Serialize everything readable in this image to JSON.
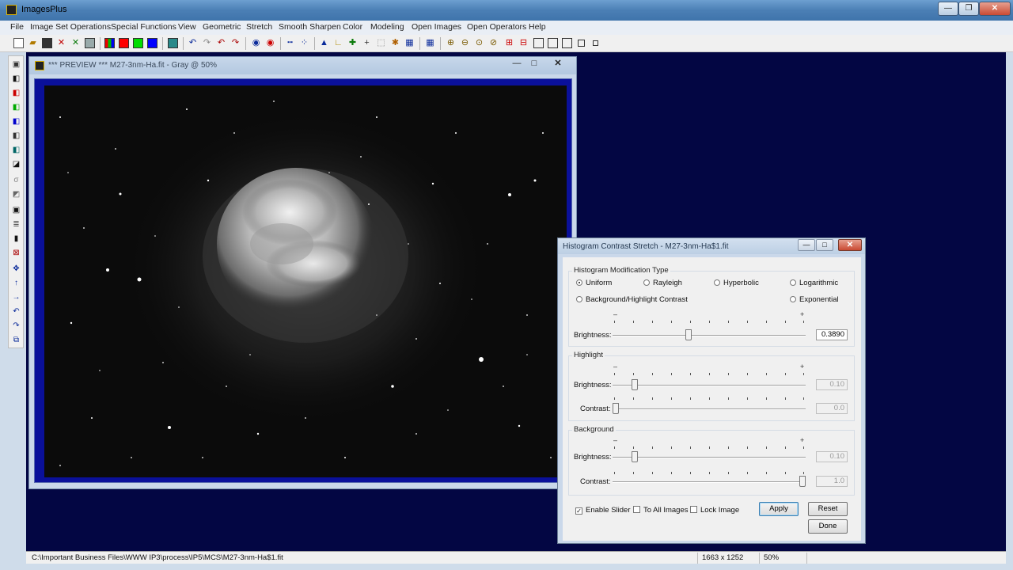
{
  "app": {
    "title": "ImagesPlus",
    "window_buttons": {
      "minimize": "—",
      "restore": "❐",
      "close": "✕"
    }
  },
  "menu": [
    "File",
    "Image Set Operations",
    "Special Functions",
    "View",
    "Geometric",
    "Stretch",
    "Smooth Sharpen",
    "Color",
    "Modeling",
    "Open Images",
    "Open Operators",
    "Help"
  ],
  "toolbar": {
    "icons": [
      "new-file-icon",
      "open-file-icon",
      "save-icon",
      "close-x-icon",
      "close-all-icon",
      "print-icon",
      "rgb-channels-icon",
      "red-channel-icon",
      "green-channel-icon",
      "blue-channel-icon",
      "grid-icon",
      "undo-icon",
      "redo-icon",
      "undo-all-icon",
      "redo-all-icon",
      "point-icon",
      "dot-icon",
      "line-icon",
      "pixel-grid-icon",
      "histogram-icon",
      "curve-icon",
      "crosshair-icon",
      "crosshair-thin-icon",
      "dashed-box-icon",
      "palette-icon",
      "table-icon",
      "pencil-icon",
      "select-icon",
      "zoom-in-icon",
      "zoom-out-icon",
      "zoom-fit-icon",
      "zoom-reset-icon",
      "zoom-plus-icon",
      "zoom-minus-icon",
      "box-icon",
      "box-2-icon",
      "box-3-icon",
      "box-4-icon",
      "box-5-icon"
    ]
  },
  "colors": {
    "workspace": "#030643",
    "frame": "#0a109a",
    "accent": "#3c7fb1"
  },
  "preview": {
    "title": "*** PREVIEW *** M27-3nm-Ha.fit - Gray @ 50%",
    "buttons": {
      "minimize": "—",
      "maximize": "□",
      "close": "✕"
    }
  },
  "dialog": {
    "title": "Histogram Contrast Stretch - M27-3nm-Ha$1.fit",
    "close": "✕",
    "modification_type": {
      "legend": "Histogram Modification Type",
      "options": [
        {
          "label": "Uniform",
          "selected": true
        },
        {
          "label": "Rayleigh",
          "selected": false
        },
        {
          "label": "Hyperbolic",
          "selected": false
        },
        {
          "label": "Logarithmic",
          "selected": false
        },
        {
          "label": "Background/Highlight Contrast",
          "selected": false
        },
        {
          "label": "Exponential",
          "selected": false
        }
      ],
      "brightness_label": "Brightness:",
      "brightness_value": "0.3890",
      "brightness_level": 0.4
    },
    "highlight": {
      "legend": "Highlight",
      "brightness_label": "Brightness:",
      "brightness_value": "0.10",
      "brightness_level": 0.1,
      "contrast_label": "Contrast:",
      "contrast_value": "0.0",
      "contrast_level": 0.0
    },
    "background": {
      "legend": "Background",
      "brightness_label": "Brightness:",
      "brightness_value": "0.10",
      "brightness_level": 0.1,
      "contrast_label": "Contrast:",
      "contrast_value": "1.0",
      "contrast_level": 1.0
    },
    "minus": "–",
    "plus": "+",
    "enable_slider": {
      "label": "Enable Slider",
      "checked": true,
      "mark": "✓"
    },
    "to_all_images": {
      "label": "To All Images",
      "checked": false
    },
    "lock_image": {
      "label": "Lock Image",
      "checked": false
    },
    "apply": "Apply",
    "reset": "Reset",
    "done": "Done"
  },
  "status": {
    "path": "C:\\Important Business Files\\WWW IP3\\process\\IP5\\MCS\\M27-3nm-Ha$1.fit",
    "dimensions": "1663 x 1252",
    "zoom": "50%"
  }
}
